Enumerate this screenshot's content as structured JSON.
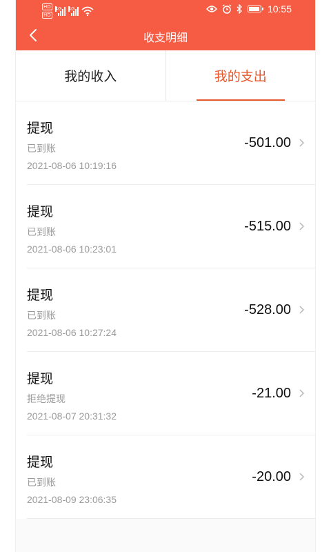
{
  "status_bar": {
    "hd1": "HD",
    "hd2": "HD",
    "net1": "4G",
    "net2": "4G",
    "time": "10:55"
  },
  "header": {
    "title": "收支明细",
    "accent_color": "#f65b43"
  },
  "tabs": [
    {
      "label": "我的收入",
      "active": false
    },
    {
      "label": "我的支出",
      "active": true
    }
  ],
  "records": [
    {
      "title": "提现",
      "status": "已到账",
      "time": "2021-08-06 10:19:16",
      "amount": "-501.00"
    },
    {
      "title": "提现",
      "status": "已到账",
      "time": "2021-08-06 10:23:01",
      "amount": "-515.00"
    },
    {
      "title": "提现",
      "status": "已到账",
      "time": "2021-08-06 10:27:24",
      "amount": "-528.00"
    },
    {
      "title": "提现",
      "status": "拒绝提现",
      "time": "2021-08-07 20:31:32",
      "amount": "-21.00"
    },
    {
      "title": "提现",
      "status": "已到账",
      "time": "2021-08-09 23:06:35",
      "amount": "-20.00"
    }
  ]
}
